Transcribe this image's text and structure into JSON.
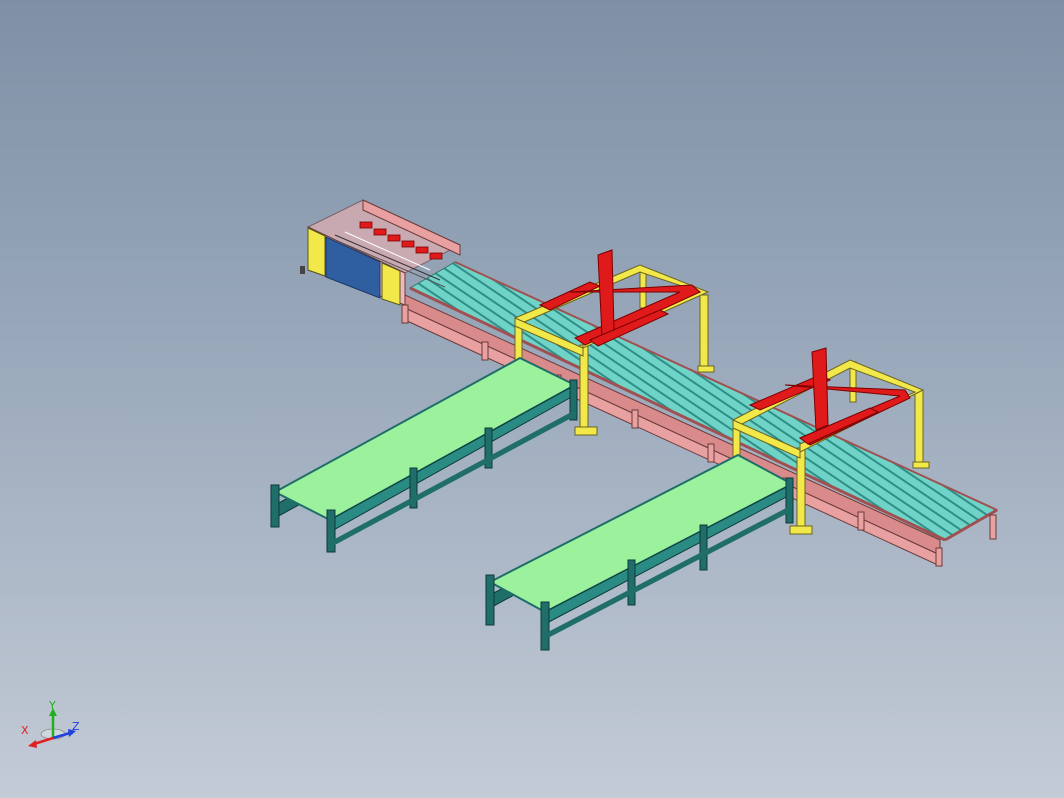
{
  "viewport": {
    "background_top": "#7f90a6",
    "background_bottom": "#c3cbd6"
  },
  "colors": {
    "main_frame": "#e8a0a0",
    "roller": "#6fd3c7",
    "gantry_yellow": "#f2e84a",
    "gantry_red": "#e01a1a",
    "side_conveyor_belt": "#9cf29c",
    "side_conveyor_frame": "#1f6e6a",
    "cabinet_panel": "#2f5fa0",
    "axis_x": "#e02020",
    "axis_y": "#20b020",
    "axis_z": "#2040e0"
  },
  "triad": {
    "x_label": "X",
    "y_label": "Y",
    "z_label": "Z"
  }
}
